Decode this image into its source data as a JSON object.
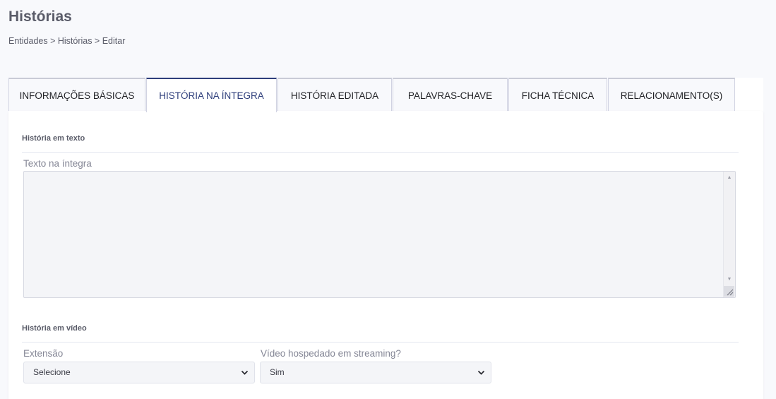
{
  "page": {
    "title": "Histórias",
    "breadcrumb": "Entidades > Histórias > Editar"
  },
  "tabs": [
    {
      "label": "INFORMAÇÕES BÁSICAS",
      "active": false
    },
    {
      "label": "HISTÓRIA NA ÍNTEGRA",
      "active": true
    },
    {
      "label": "HISTÓRIA EDITADA",
      "active": false
    },
    {
      "label": "PALAVRAS-CHAVE",
      "active": false
    },
    {
      "label": "FICHA TÉCNICA",
      "active": false
    },
    {
      "label": "RELACIONAMENTO(S)",
      "active": false
    }
  ],
  "text_section": {
    "title": "História em texto",
    "field_label": "Texto na íntegra",
    "value": ""
  },
  "video_section": {
    "title": "História em vídeo",
    "extension_label": "Extensão",
    "extension_value": "Selecione",
    "streaming_label": "Vídeo hospedado em streaming?",
    "streaming_value": "Sim"
  },
  "colors": {
    "accent": "#2e3e7b",
    "background": "#f8f9fc",
    "border": "#d1d3e2"
  }
}
